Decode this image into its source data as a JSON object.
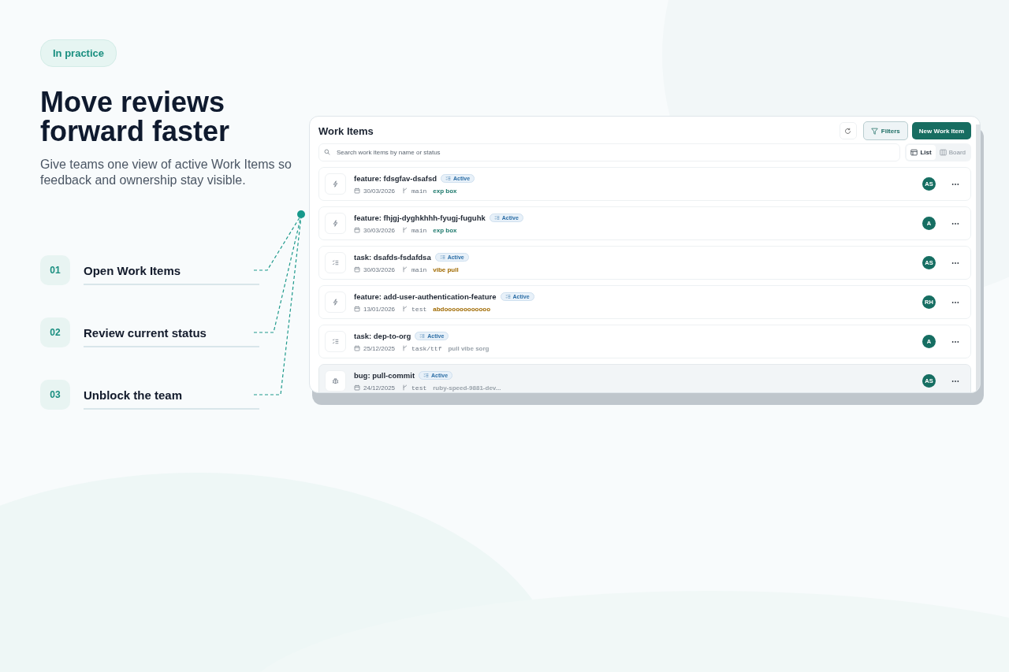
{
  "eyebrow": "In practice",
  "headline": "Move reviews forward faster",
  "intro": "Give teams one view of active Work Items so feedback and ownership stay visible.",
  "steps": [
    {
      "number": "01",
      "label": "Open Work Items"
    },
    {
      "number": "02",
      "label": "Review current status"
    },
    {
      "number": "03",
      "label": "Unblock the team"
    }
  ],
  "app": {
    "title": "Work Items",
    "filters": "Filters",
    "new_item": "New Work Item",
    "search": {
      "placeholder": "Search work items by name or status"
    },
    "views": [
      {
        "kind": "list",
        "label": "List",
        "selected": true
      },
      {
        "kind": "board",
        "label": "Board",
        "selected": false
      }
    ],
    "items": [
      {
        "kind": "feature",
        "title": "feature: fdsgfav-dsafsd",
        "status": "Active",
        "date": "30/03/2026",
        "branch": "main",
        "tag": {
          "text": "exp box",
          "color": "#1f7a6d"
        },
        "assignee": "AS",
        "selected": false
      },
      {
        "kind": "feature",
        "title": "feature: fhjgj-dyghkhhh-fyugj-fuguhk",
        "status": "Active",
        "date": "30/03/2026",
        "branch": "main",
        "tag": {
          "text": "exp box",
          "color": "#1f7a6d"
        },
        "assignee": "A",
        "selected": false
      },
      {
        "kind": "task",
        "title": "task: dsafds-fsdafdsa",
        "status": "Active",
        "date": "30/03/2026",
        "branch": "main",
        "tag": {
          "text": "vibe pull",
          "color": "#a06a00"
        },
        "assignee": "AS",
        "selected": false
      },
      {
        "kind": "feature",
        "title": "feature: add-user-authentication-feature",
        "status": "Active",
        "date": "13/01/2026",
        "branch": "test",
        "tag": {
          "text": "abdoooooooooooo",
          "color": "#a06a00"
        },
        "assignee": "RH",
        "selected": false
      },
      {
        "kind": "task",
        "title": "task: dep-to-org",
        "status": "Active",
        "date": "25/12/2025",
        "branch": "task/ttf",
        "tag": {
          "text": "pull vibe sorg",
          "color": "#9aa3ab"
        },
        "assignee": "A",
        "selected": false
      },
      {
        "kind": "bug",
        "title": "bug: pull-commit",
        "status": "Active",
        "date": "24/12/2025",
        "branch": "test",
        "tag": {
          "text": "ruby-speed-9881-dev...",
          "color": "#9aa3ab"
        },
        "assignee": "AS",
        "selected": true
      }
    ]
  }
}
